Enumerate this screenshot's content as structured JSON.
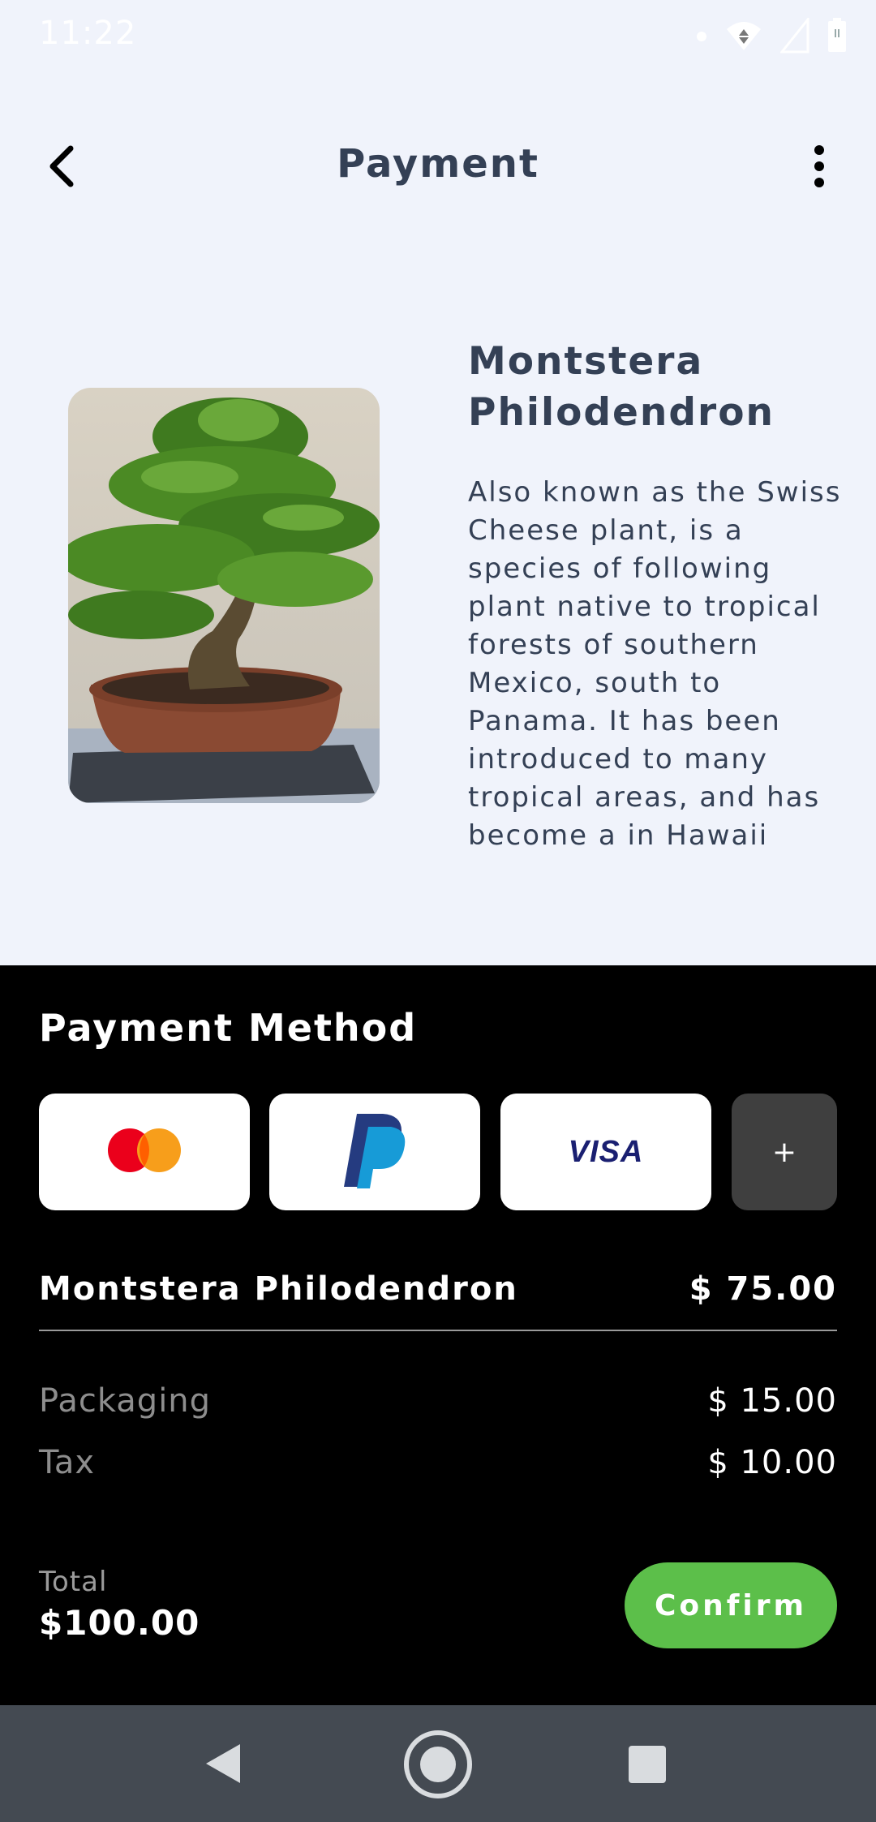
{
  "status_bar": {
    "time": "11:22"
  },
  "header": {
    "title": "Payment"
  },
  "product": {
    "name": "Montstera Philodendron",
    "description": "Also known as the Swiss Cheese plant, is a species of following plant native to tropical forests of southern Mexico, south to Panama. It has been introduced to many tropical areas, and has become a in Hawaii"
  },
  "payment": {
    "section_title": "Payment Method",
    "methods": [
      {
        "icon": "mastercard-icon"
      },
      {
        "icon": "paypal-icon"
      },
      {
        "icon": "visa-icon",
        "label": "VISA"
      }
    ],
    "add_label": "+"
  },
  "order": {
    "item_name": "Montstera Philodendron",
    "item_price": "$ 75.00",
    "fees": [
      {
        "label": "Packaging",
        "value": "$ 15.00"
      },
      {
        "label": "Tax",
        "value": "$ 10.00"
      }
    ],
    "total_label": "Total",
    "total_value": "$100.00",
    "confirm_label": "Confirm"
  },
  "colors": {
    "accent_green": "#5cbf4a",
    "title_text": "#344055",
    "sheet_bg": "#000000",
    "page_bg": "#f0f3fb"
  }
}
